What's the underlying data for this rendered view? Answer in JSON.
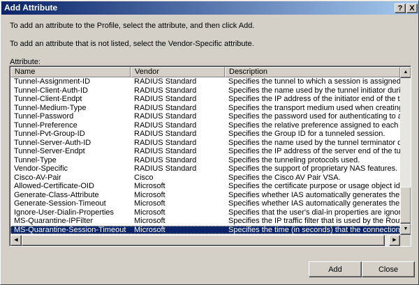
{
  "window": {
    "title": "Add Attribute",
    "help_label": "?",
    "close_label": "X"
  },
  "instructions": {
    "line1": "To add an attribute to the Profile, select the attribute, and then click Add.",
    "line2": "To add an attribute that is not listed, select the Vendor-Specific attribute."
  },
  "attribute_label": "Attribute:",
  "columns": {
    "name": "Name",
    "vendor": "Vendor",
    "description": "Description"
  },
  "rows": [
    {
      "name": "Tunnel-Assignment-ID",
      "vendor": "RADIUS Standard",
      "description": "Specifies the tunnel to which a session is assigned."
    },
    {
      "name": "Tunnel-Client-Auth-ID",
      "vendor": "RADIUS Standard",
      "description": "Specifies the name used by the tunnel initiator during the a"
    },
    {
      "name": "Tunnel-Client-Endpt",
      "vendor": "RADIUS Standard",
      "description": "Specifies the IP address of the initiator end of the tunnel."
    },
    {
      "name": "Tunnel-Medium-Type",
      "vendor": "RADIUS Standard",
      "description": "Specifies the transport medium used when creating a tunn"
    },
    {
      "name": "Tunnel-Password",
      "vendor": "RADIUS Standard",
      "description": "Specifies the password used for authenticating to a remote"
    },
    {
      "name": "Tunnel-Preference",
      "vendor": "RADIUS Standard",
      "description": "Specifies the relative preference assigned to each tunnel w"
    },
    {
      "name": "Tunnel-Pvt-Group-ID",
      "vendor": "RADIUS Standard",
      "description": "Specifies the Group ID for a tunneled session."
    },
    {
      "name": "Tunnel-Server-Auth-ID",
      "vendor": "RADIUS Standard",
      "description": "Specifies the name used by the tunnel terminator during th"
    },
    {
      "name": "Tunnel-Server-Endpt",
      "vendor": "RADIUS Standard",
      "description": "Specifies the IP address of the server end of the tunnel."
    },
    {
      "name": "Tunnel-Type",
      "vendor": "RADIUS Standard",
      "description": "Specifies the tunneling protocols used."
    },
    {
      "name": "Vendor-Specific",
      "vendor": "RADIUS Standard",
      "description": "Specifies the support of proprietary NAS features."
    },
    {
      "name": "Cisco-AV-Pair",
      "vendor": "Cisco",
      "description": "Specifies the Cisco AV Pair VSA."
    },
    {
      "name": "Allowed-Certificate-OID",
      "vendor": "Microsoft",
      "description": "Specifies the certificate purpose or usage object identifiers"
    },
    {
      "name": "Generate-Class-Attribute",
      "vendor": "Microsoft",
      "description": "Specifies whether IAS automatically generates the class at"
    },
    {
      "name": "Generate-Session-Timeout",
      "vendor": "Microsoft",
      "description": "Specifies whether IAS automatically generates the session"
    },
    {
      "name": "Ignore-User-Dialin-Properties",
      "vendor": "Microsoft",
      "description": "Specifies that the user's dial-in properties are ignored."
    },
    {
      "name": "MS-Quarantine-IPFilter",
      "vendor": "Microsoft",
      "description": "Specifies the IP traffic filter that is used by the Routing and"
    },
    {
      "name": "MS-Quarantine-Session-Timeout",
      "vendor": "Microsoft",
      "description": "Specifies the time (in seconds) that the connection can re"
    }
  ],
  "selected_row": "MS-Quarantine-Session-Timeout",
  "scroll": {
    "up_icon": "triangle-up-icon",
    "down_icon": "triangle-down-icon",
    "left_icon": "triangle-left-icon",
    "right_icon": "triangle-right-icon",
    "vertical_position": 1.0,
    "horizontal_position": 0.0
  },
  "buttons": {
    "add": "Add",
    "close": "Close"
  },
  "colors": {
    "titlebar": "#0a246a",
    "selection": "#0a246a",
    "face": "#d4d0c8"
  }
}
